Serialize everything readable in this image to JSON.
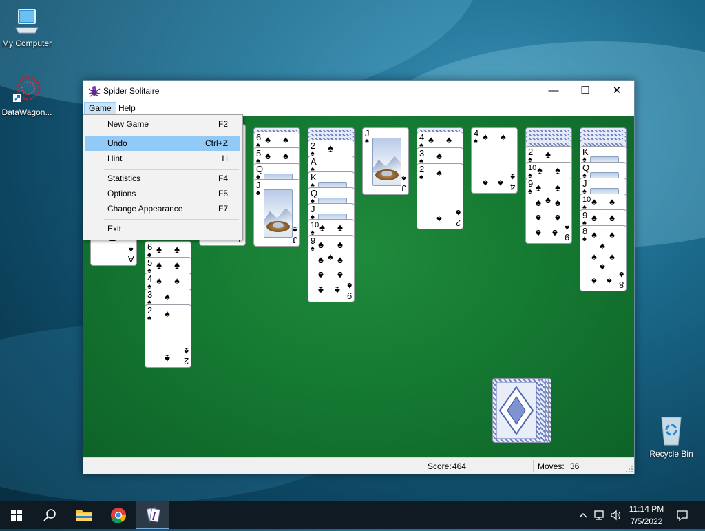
{
  "desktop": {
    "icons": [
      {
        "label": "My Computer"
      },
      {
        "label": "DataWagon..."
      },
      {
        "label": "Recycle Bin"
      }
    ]
  },
  "window": {
    "title": "Spider Solitaire",
    "controls": {
      "minimize": "—",
      "maximize": "☐",
      "close": "✕"
    }
  },
  "menubar": {
    "game": "Game",
    "help": "Help"
  },
  "game_menu": {
    "items": [
      {
        "label": "New Game",
        "shortcut": "F2"
      },
      {
        "label": "Undo",
        "shortcut": "Ctrl+Z",
        "highlighted": true
      },
      {
        "label": "Hint",
        "shortcut": "H"
      },
      {
        "label": "Statistics",
        "shortcut": "F4"
      },
      {
        "label": "Options",
        "shortcut": "F5"
      },
      {
        "label": "Change Appearance",
        "shortcut": "F7"
      },
      {
        "label": "Exit",
        "shortcut": ""
      }
    ]
  },
  "cards": {
    "suit": "♠",
    "col1_bottom": "A",
    "col2": [
      "6",
      "5",
      "4",
      "3",
      "2"
    ],
    "col3_bottom": "J",
    "col4": [
      "6",
      "5",
      "Q",
      "J"
    ],
    "col5": [
      "2",
      "A",
      "K",
      "Q",
      "J",
      "10",
      "9"
    ],
    "col6": [
      "J"
    ],
    "col7": [
      "4",
      "3",
      "2"
    ],
    "col8": [
      "4"
    ],
    "col9": [
      "2",
      "10",
      "9"
    ],
    "col10": [
      "K",
      "Q",
      "J",
      "10",
      "9",
      "8"
    ]
  },
  "status": {
    "score_label": "Score:",
    "score": "464",
    "moves_label": "Moves:",
    "moves": "36"
  },
  "taskbar": {
    "time": "11:14 PM",
    "date": "7/5/2022"
  }
}
